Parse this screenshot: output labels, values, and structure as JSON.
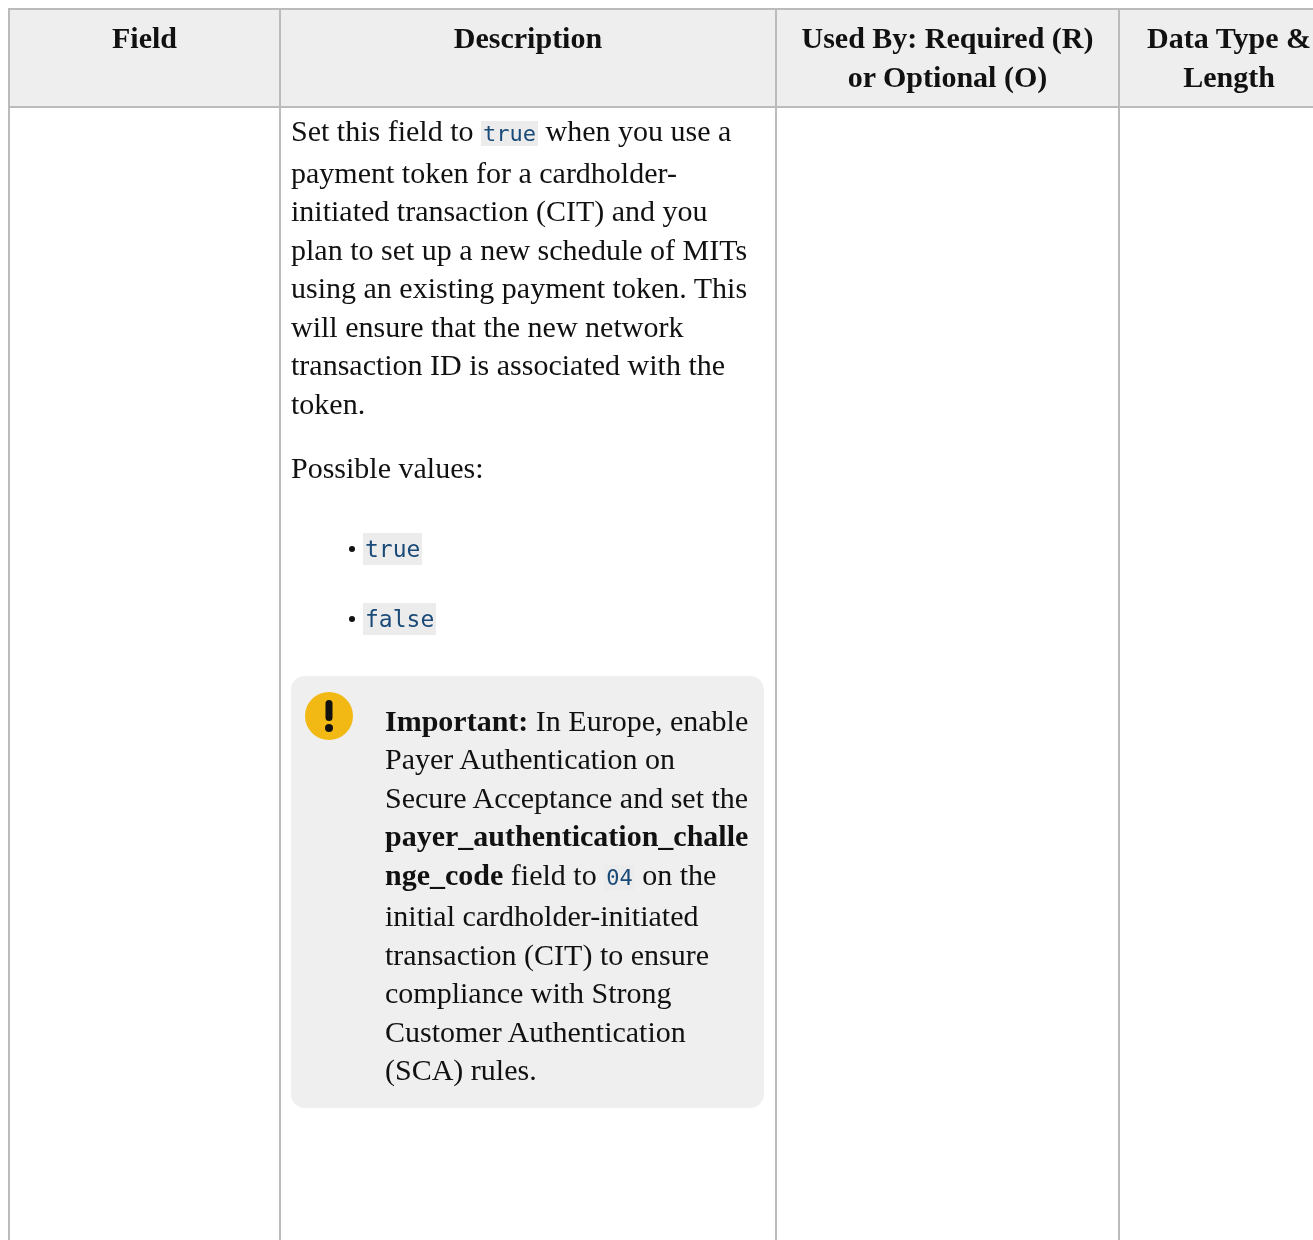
{
  "table": {
    "columns": [
      "Field",
      "Description",
      "Used By: Required (R) or Optional (O)",
      "Data Type & Length"
    ],
    "rows": [
      {
        "description": {
          "intro": [
            {
              "kind": "text",
              "text": "Set this field to "
            },
            {
              "kind": "code",
              "text": "true"
            },
            {
              "kind": "text",
              "text": " when you use a payment token for a cardholder-initiated transaction (CIT) and you plan to set up a new schedule of MITs using an existing payment token. This will ensure that the new network transaction ID is associated with the token."
            }
          ],
          "values_label": "Possible values:",
          "values": [
            "true",
            "false"
          ],
          "note": [
            {
              "kind": "bold",
              "text": "Important:"
            },
            {
              "kind": "text",
              "text": " In Europe, enable Payer Authentication on Secure Acceptance and set the "
            },
            {
              "kind": "bold",
              "text": "payer_authentication_challenge_code"
            },
            {
              "kind": "text",
              "text": " field to "
            },
            {
              "kind": "code",
              "text": "04"
            },
            {
              "kind": "text",
              "text": " on the initial cardholder-initiated transaction (CIT) to ensure compliance with Strong Customer Authentication (SCA) rules."
            }
          ]
        }
      }
    ]
  }
}
